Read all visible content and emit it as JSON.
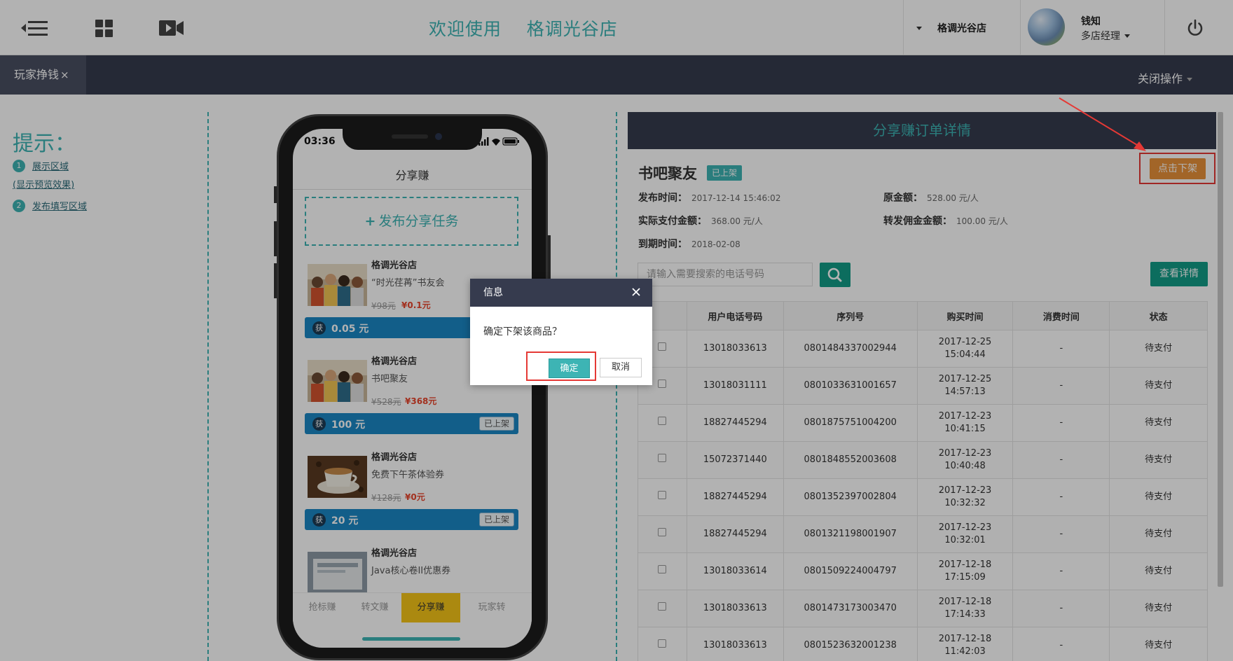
{
  "header": {
    "title": "欢迎使用    格调光谷店",
    "store_selector": "格调光谷店",
    "user_name": "钱知",
    "user_role": "多店经理"
  },
  "nav": {
    "active_tab": "玩家挣钱",
    "tab_close": "×",
    "close_ops": "关闭操作"
  },
  "hints": {
    "title": "提示：",
    "items": [
      {
        "num": "1",
        "label": "展示区域",
        "sub": "(显示预览效果)"
      },
      {
        "num": "2",
        "label": "发布填写区域"
      }
    ]
  },
  "phone": {
    "time": "03:36",
    "title": "分享赚",
    "publish": "发布分享任务",
    "cards": [
      {
        "store": "格调光谷店",
        "name": "“时光荏苒”书友会",
        "old_price": "¥98元",
        "new_price": "¥0.1元",
        "get": "获",
        "amount": "0.05 元",
        "badge": ""
      },
      {
        "store": "格调光谷店",
        "name": "书吧聚友",
        "old_price": "¥528元",
        "new_price": "¥368元",
        "get": "获",
        "amount": "100 元",
        "badge": "已上架"
      },
      {
        "store": "格调光谷店",
        "name": "免费下午茶体验券",
        "old_price": "¥128元",
        "new_price": "¥0元",
        "get": "获",
        "amount": "20 元",
        "badge": "已上架"
      },
      {
        "store": "格调光谷店",
        "name": "Java核心卷II优惠券"
      }
    ],
    "tabs": [
      "抢标赚",
      "转文赚",
      "分享赚",
      "玩家转"
    ]
  },
  "panel": {
    "title": "分享赚订单详情",
    "product_name": "书吧聚友",
    "status": "已上架",
    "offline_button": "点击下架",
    "publish_time_label": "发布时间：",
    "publish_time": "2017-12-14 15:46:02",
    "orig_amount_label": "原金额：",
    "orig_amount": "528.00 元/人",
    "paid_amount_label": "实际支付金额：",
    "paid_amount": "368.00 元/人",
    "commission_label": "转发佣金金额：",
    "commission": "100.00 元/人",
    "expire_label": "到期时间：",
    "expire": "2018-02-08",
    "search_placeholder": "请输入需要搜索的电话号码",
    "detail_button": "查看详情",
    "columns": [
      "",
      "用户电话号码",
      "序列号",
      "购买时间",
      "消费时间",
      "状态"
    ],
    "rows": [
      {
        "phone": "13018033613",
        "serial": "0801484337002944",
        "date": "2017-12-25",
        "time": "15:04:44",
        "consume": "-",
        "status": "待支付"
      },
      {
        "phone": "13018031111",
        "serial": "0801033631001657",
        "date": "2017-12-25",
        "time": "14:57:13",
        "consume": "-",
        "status": "待支付"
      },
      {
        "phone": "18827445294",
        "serial": "0801875751004200",
        "date": "2017-12-23",
        "time": "10:41:15",
        "consume": "-",
        "status": "待支付"
      },
      {
        "phone": "15072371440",
        "serial": "0801848552003608",
        "date": "2017-12-23",
        "time": "10:40:48",
        "consume": "-",
        "status": "待支付"
      },
      {
        "phone": "18827445294",
        "serial": "0801352397002804",
        "date": "2017-12-23",
        "time": "10:32:32",
        "consume": "-",
        "status": "待支付"
      },
      {
        "phone": "18827445294",
        "serial": "0801321198001907",
        "date": "2017-12-23",
        "time": "10:32:01",
        "consume": "-",
        "status": "待支付"
      },
      {
        "phone": "13018033614",
        "serial": "0801509224004797",
        "date": "2017-12-18",
        "time": "17:15:09",
        "consume": "-",
        "status": "待支付"
      },
      {
        "phone": "13018033613",
        "serial": "0801473173003470",
        "date": "2017-12-18",
        "time": "17:14:33",
        "consume": "-",
        "status": "待支付"
      },
      {
        "phone": "13018033613",
        "serial": "0801523632001238",
        "date": "2017-12-18",
        "time": "11:42:03",
        "consume": "-",
        "status": "待支付"
      }
    ]
  },
  "dialog": {
    "title": "信息",
    "message": "确定下架该商品？",
    "ok": "确定",
    "cancel": "取消"
  },
  "colors": {
    "teal": "#3db4b4",
    "navy": "#363b4e",
    "orange": "#e8913a",
    "red_highlight": "#e53935"
  }
}
